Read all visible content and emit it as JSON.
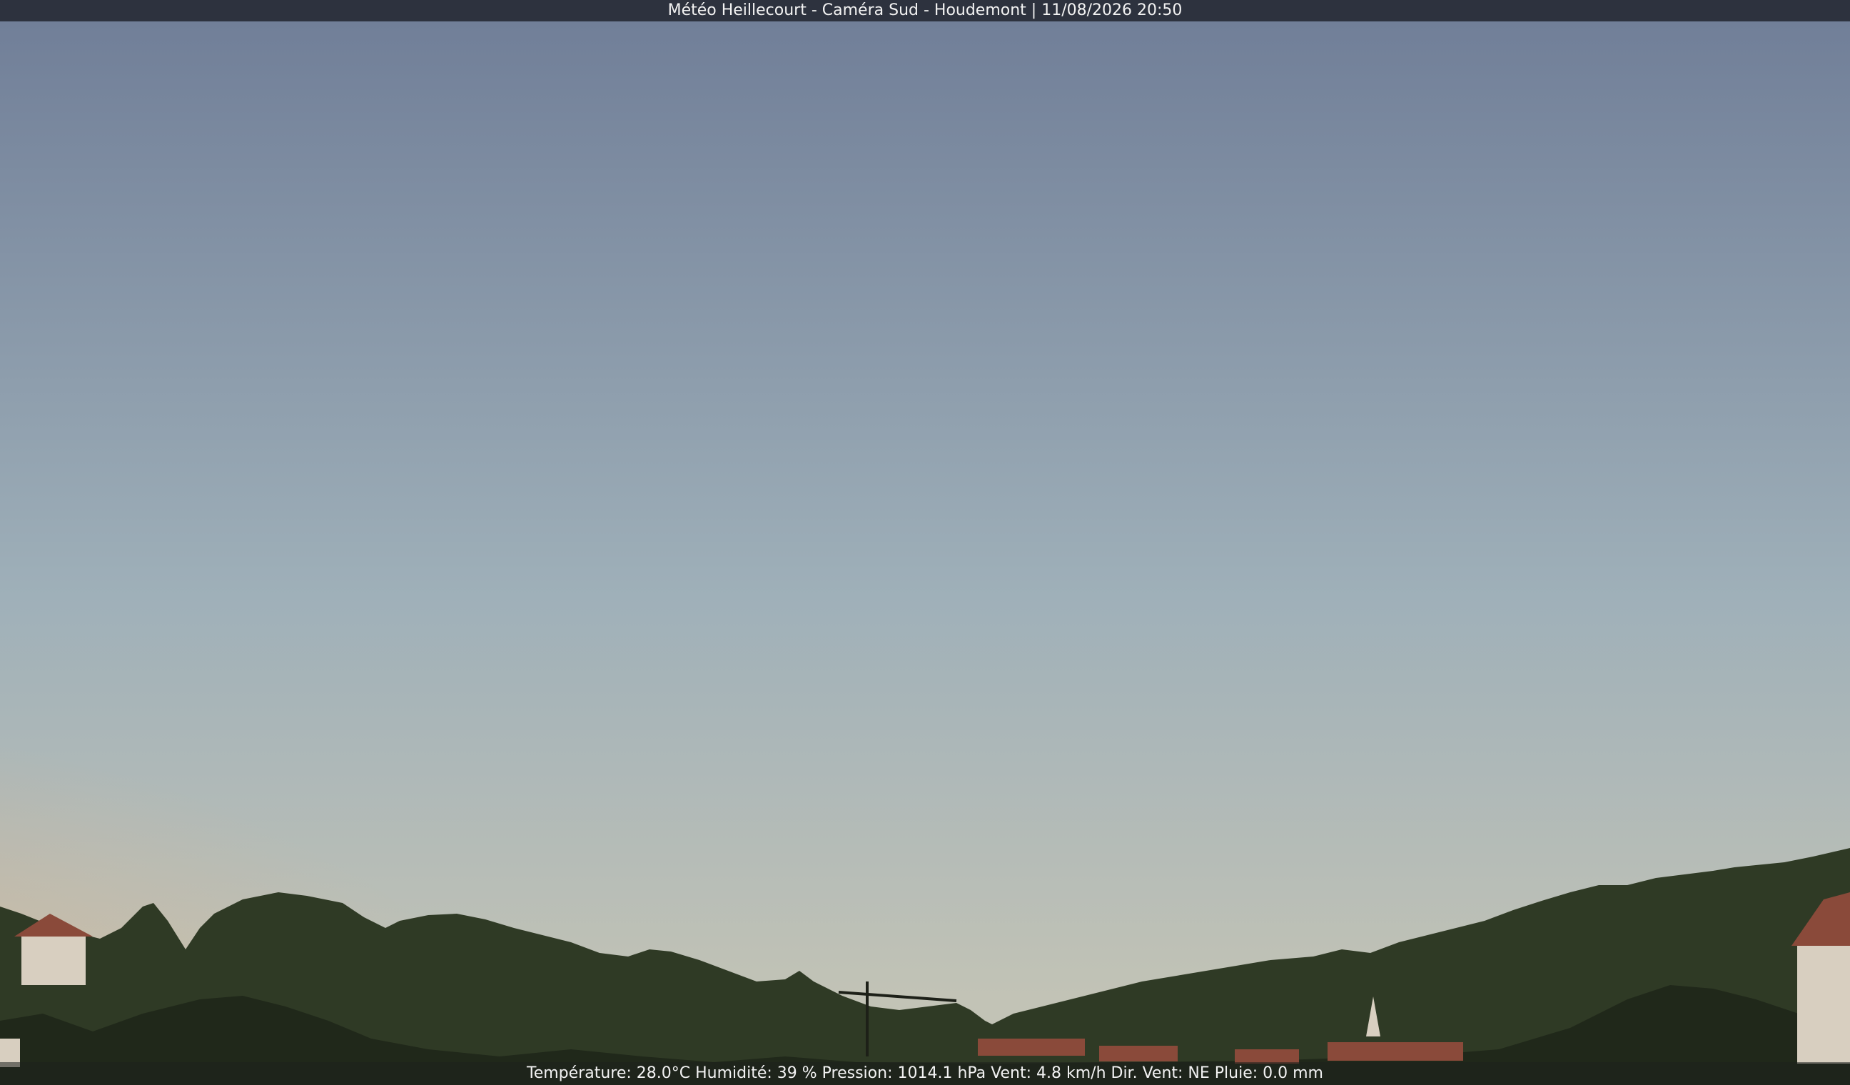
{
  "header": {
    "caption": "Météo Heillecourt - Caméra Sud - Houdemont | 11/08/2026 20:50"
  },
  "footer": {
    "weather_line": "Température: 28.0°C  Humidité: 39 % Pression: 1014.1 hPa Vent: 4.8 km/h Dir. Vent: NE Pluie: 0.0 mm"
  },
  "scene": {
    "sky_top_color": "#6f7d97",
    "sky_mid_color": "#9fb0b9",
    "sky_low_color": "#c2c3b6",
    "horizon_glow_color": "#d9b48f",
    "vegetation_color": "#2f3a25",
    "roof_color": "#8a4a3a",
    "wall_color": "#d8cfc0"
  }
}
